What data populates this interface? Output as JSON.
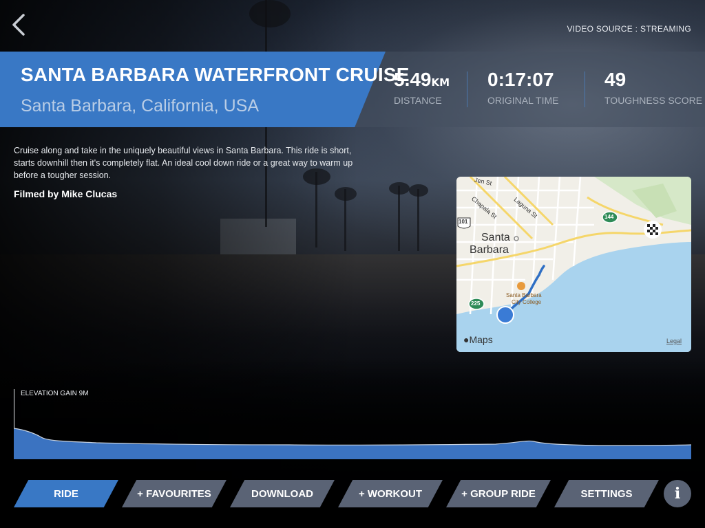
{
  "header": {
    "video_source": "VIDEO SOURCE : STREAMING"
  },
  "route": {
    "title": "SANTA BARBARA WATERFRONT CRUISE",
    "location": "Santa Barbara, California, USA"
  },
  "stats": [
    {
      "value": "5.49",
      "unit": "KM",
      "label": "DISTANCE"
    },
    {
      "value": "0:17:07",
      "unit": "",
      "label": "ORIGINAL TIME"
    },
    {
      "value": "49",
      "unit": "",
      "label": "TOUGHNESS SCORE"
    }
  ],
  "description": {
    "text": "Cruise along and take in the uniquely beautiful views in Santa Barbara. This ride is short, starts downhill then it's completely flat. An ideal cool down ride or a great way to warm up before a tougher session.",
    "credit": "Filmed by Mike Clucas"
  },
  "map": {
    "city_label_1": "Santa",
    "city_label_2": "Barbara",
    "street_1": "Jen St",
    "street_2": "Chapala St",
    "street_3": "Laguna St",
    "college_1": "Santa Barbara",
    "college_2": "City College",
    "highway_101": "101",
    "highway_144": "144",
    "highway_225": "225",
    "brand": "Maps",
    "legal": "Legal"
  },
  "elevation": {
    "label": "ELEVATION GAIN 9M"
  },
  "nav": {
    "ride": "RIDE",
    "favourites": "+ FAVOURITES",
    "download": "DOWNLOAD",
    "workout": "+ WORKOUT",
    "group_ride": "+ GROUP RIDE",
    "settings": "SETTINGS",
    "info": "i"
  },
  "colors": {
    "accent": "#3978c5",
    "nav_inactive": "#5a6375"
  }
}
